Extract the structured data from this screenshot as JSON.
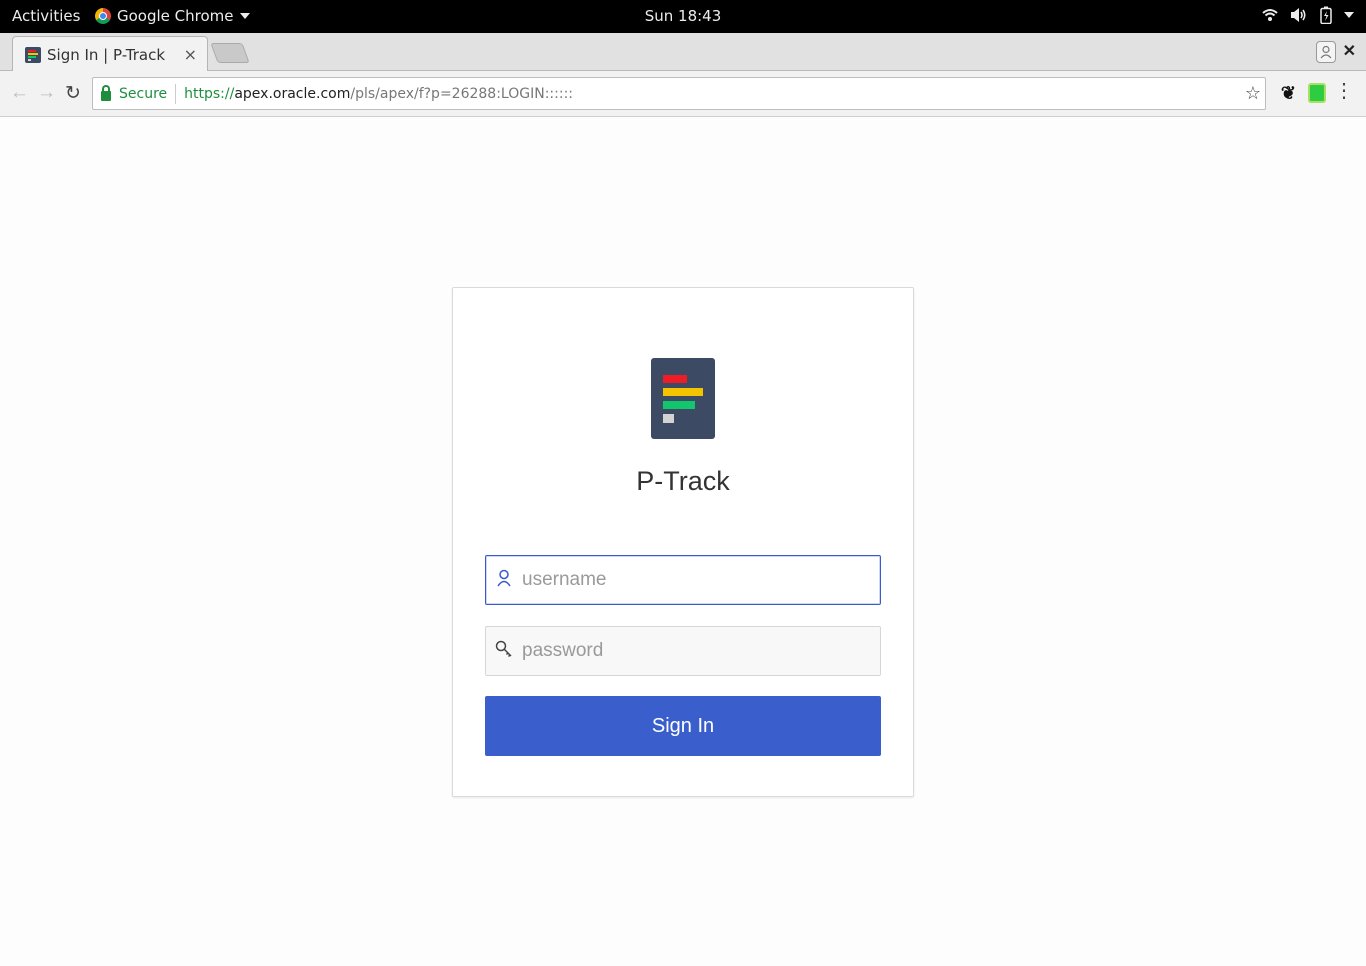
{
  "topbar": {
    "activities": "Activities",
    "app_name": "Google Chrome",
    "clock": "Sun 18:43"
  },
  "browser": {
    "tab_title": "Sign In | P-Track",
    "tab_close": "×",
    "secure_label": "Secure",
    "url_scheme": "https://",
    "url_host": "apex.oracle.com",
    "url_path": "/pls/apex/f?p=26288:LOGIN::::::"
  },
  "login": {
    "app_title": "P-Track",
    "username_placeholder": "username",
    "password_placeholder": "password",
    "signin_label": "Sign In"
  },
  "colors": {
    "primary": "#3a5ecc",
    "logo_bg": "#3c4a63",
    "logo_bars": [
      "#ee1c25",
      "#f5c400",
      "#12c66b",
      "#d3d3d3"
    ]
  },
  "icons": {
    "username": "user-icon",
    "password": "key-icon"
  }
}
